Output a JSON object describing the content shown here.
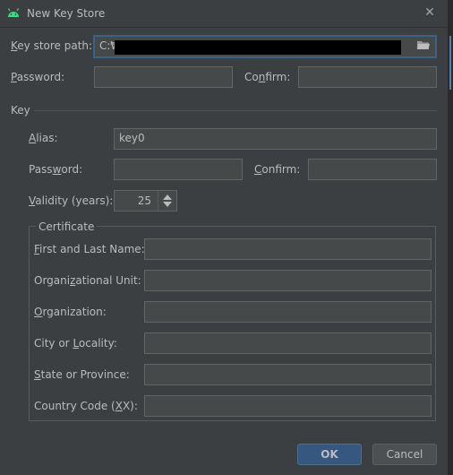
{
  "window": {
    "title": "New Key Store"
  },
  "keystore": {
    "path_label_u": "K",
    "path_label_rest": "ey store path:",
    "path_value": "C:₩",
    "password_label_u": "P",
    "password_label_rest": "assword:",
    "confirm_label_pre": "Co",
    "confirm_label_u": "n",
    "confirm_label_rest": "firm:"
  },
  "key": {
    "section_label": "Key",
    "alias_label_u": "A",
    "alias_label_rest": "lias:",
    "alias_value": "key0",
    "password_label_pre": "Pass",
    "password_label_u": "w",
    "password_label_rest": "ord:",
    "confirm_label_u": "C",
    "confirm_label_rest": "onfirm:",
    "validity_label_u": "V",
    "validity_label_rest": "alidity (years):",
    "validity_value": "25"
  },
  "certificate": {
    "title": "Certificate",
    "first_last_u": "F",
    "first_last_rest": "irst and Last Name:",
    "org_unit_pre": "Organi",
    "org_unit_u": "z",
    "org_unit_rest": "ational Unit:",
    "org_u": "O",
    "org_rest": "rganization:",
    "city_pre": "City or ",
    "city_u": "L",
    "city_rest": "ocality:",
    "state_u": "S",
    "state_rest": "tate or Province:",
    "country_pre": "Country Code (",
    "country_u": "X",
    "country_rest": "X):"
  },
  "buttons": {
    "ok": "OK",
    "cancel": "Cancel"
  },
  "icons": {
    "title": "android-icon",
    "browse": "folder-icon",
    "close": "close-icon"
  },
  "colors": {
    "accent": "#3d6185",
    "android_green": "#3ddc84",
    "ok_button": "#365880"
  }
}
